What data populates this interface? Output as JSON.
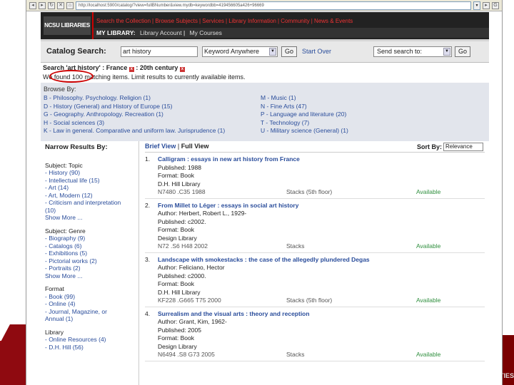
{
  "browser": {
    "url": "http://localhost:5900/catalog/?view=fullBNumber&view.mydb=keywordbb=419456605a426+96669"
  },
  "slide": {
    "side_text": "TIES"
  },
  "header": {
    "logo": "NCSU LIBRARIES",
    "nav_top": [
      "Search the Collection",
      "Browse Subjects",
      "Services",
      "Library Information",
      "Community",
      "News & Events"
    ],
    "my_library": "MY LIBRARY:",
    "my_library_links": [
      "Library Account",
      "My Courses"
    ]
  },
  "search": {
    "title": "Catalog Search:",
    "query": "art history",
    "field": "Keyword Anywhere",
    "go": "Go",
    "start_over": "Start Over",
    "send_to": "Send search to:",
    "go2": "Go"
  },
  "summary": {
    "line1": "Search 'art history' : France",
    "line1b": ": 20th century",
    "line2": "We found 100 matching items. Limit results to currently available items."
  },
  "browse": {
    "title": "Browse By:",
    "left": [
      "B - Philosophy. Psychology. Religion (1)",
      "D - History (General) and History of Europe (15)",
      "G - Geography. Anthropology. Recreation (1)",
      "H - Social sciences (3)",
      "K - Law in general. Comparative and uniform law. Jurisprudence (1)"
    ],
    "right": [
      "M - Music (1)",
      "N - Fine Arts (47)",
      "P - Language and literature (20)",
      "T - Technology (7)",
      "U - Military science (General) (1)"
    ]
  },
  "narrow": {
    "title": "Narrow Results By:",
    "topic_head": "Subject: Topic",
    "topic": [
      "- History (90)",
      "- Intellectual life (15)",
      "- Art (14)",
      "- Art, Modern (12)",
      "- Criticism and interpretation",
      "(10)",
      "Show More ..."
    ],
    "genre_head": "Subject: Genre",
    "genre": [
      "- Biography (9)",
      "- Catalogs (6)",
      "- Exhibitions (5)",
      "- Pictorial works (2)",
      "- Portraits (2)",
      "Show More ..."
    ],
    "format_head": "Format",
    "format": [
      "- Book (99)",
      "- Online (4)",
      "- Journal, Magazine, or",
      "Annual (1)"
    ],
    "library_head": "Library",
    "library": [
      "- Online Resources (4)",
      "- D.H. Hill (56)"
    ]
  },
  "results": {
    "brief": "Brief View",
    "full": "Full View",
    "sort_by": "Sort By:",
    "sort_value": "Relevance",
    "records": [
      {
        "num": "1.",
        "title": "Calligram : essays in new art history from France",
        "meta": [
          "Published: 1988",
          "Format: Book",
          "D.H. Hill Library"
        ],
        "call": "N7480 .C35 1988",
        "loc": "Stacks (5th floor)",
        "status": "Available"
      },
      {
        "num": "2.",
        "title": "From Millet to Léger : essays in social art history",
        "meta": [
          "Author: Herbert, Robert L., 1929-",
          "Published: c2002.",
          "Format: Book",
          "Design Library"
        ],
        "call": "N72 .S6 H48 2002",
        "loc": "Stacks",
        "status": "Available"
      },
      {
        "num": "3.",
        "title": "Landscape with smokestacks : the case of the allegedly plundered Degas",
        "meta": [
          "Author: Feliciano, Hector",
          "Published: c2000.",
          "Format: Book",
          "D.H. Hill Library"
        ],
        "call": "KF228 .G665 T75 2000",
        "loc": "Stacks (5th floor)",
        "status": "Available"
      },
      {
        "num": "4.",
        "title": "Surrealism and the visual arts : theory and reception",
        "meta": [
          "Author: Grant, Kim, 1962-",
          "Published: 2005",
          "Format: Book",
          "Design Library"
        ],
        "call": "N6494 .S8 G73 2005",
        "loc": "Stacks",
        "status": "Available"
      }
    ]
  }
}
